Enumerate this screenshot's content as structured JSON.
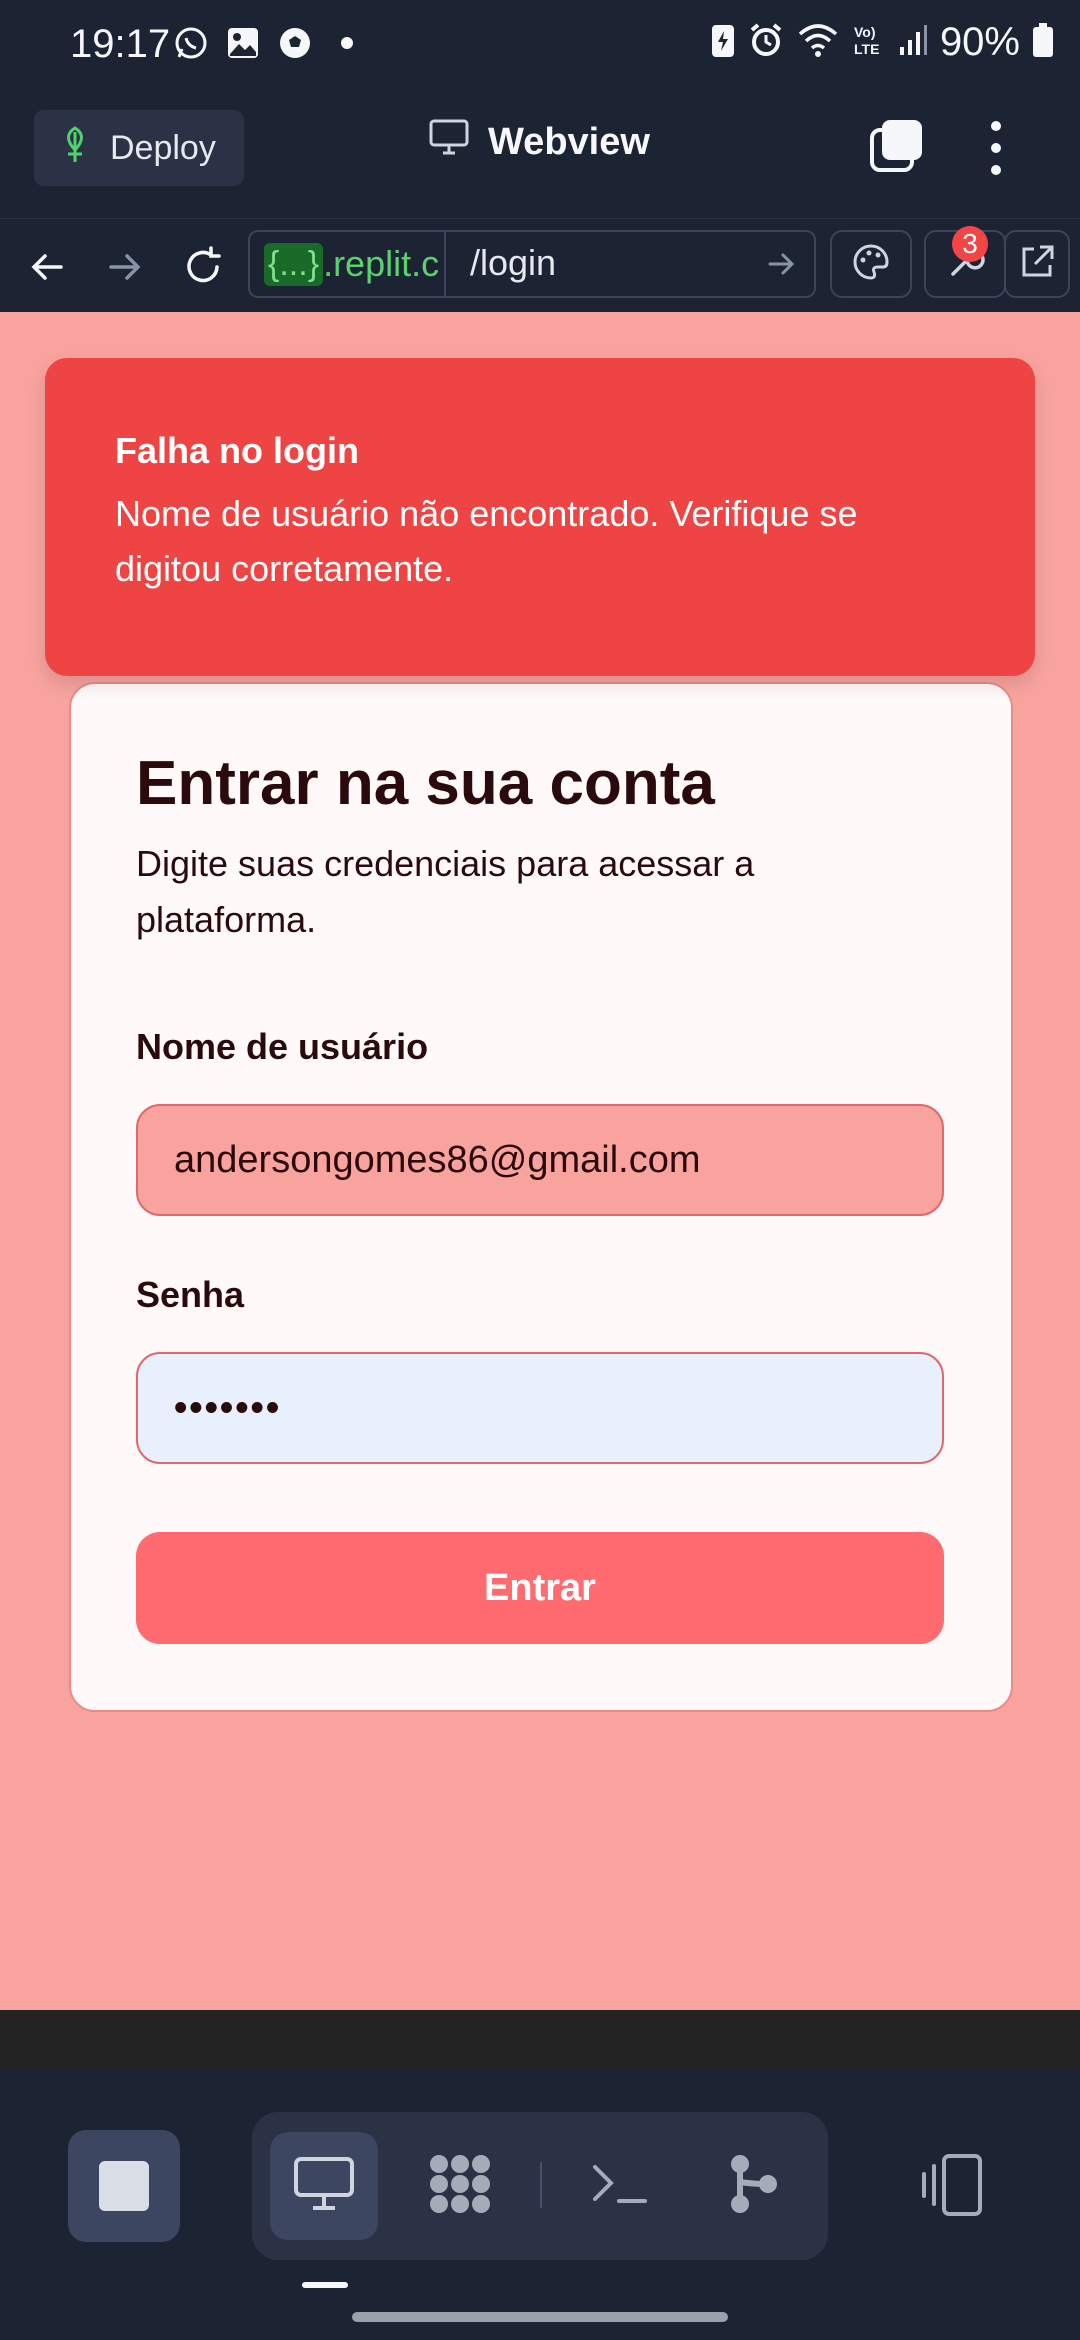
{
  "status_bar": {
    "time": "19:17",
    "battery": "90%",
    "left_icons": [
      "whatsapp-icon",
      "gallery-icon",
      "soccer-icon",
      "dot-icon"
    ],
    "right_icons": [
      "battery-saver-icon",
      "alarm-icon",
      "wifi-icon",
      "volte-icon",
      "signal-icon",
      "battery-icon"
    ]
  },
  "header": {
    "deploy_label": "Deploy",
    "title": "Webview"
  },
  "url_bar": {
    "braces": "{...}",
    "domain": ".replit.c",
    "path": "/login"
  },
  "toolbar": {
    "devtools_badge": "3"
  },
  "alert": {
    "title": "Falha no login",
    "message": "Nome de usuário não encontrado. Verifique se digitou corretamente."
  },
  "login": {
    "title": "Entrar na sua conta",
    "subtitle": "Digite suas credenciais para acessar a plataforma.",
    "username_label": "Nome de usuário",
    "username_value": "andersongomes86@gmail.com",
    "password_label": "Senha",
    "password_value": "•••••••",
    "submit_label": "Entrar"
  },
  "colors": {
    "app_bg": "#1c2333",
    "page_bg": "#f8a39e",
    "alert_bg": "#ef4444",
    "button_bg": "#ff6b6f",
    "badge": "#f24646"
  }
}
